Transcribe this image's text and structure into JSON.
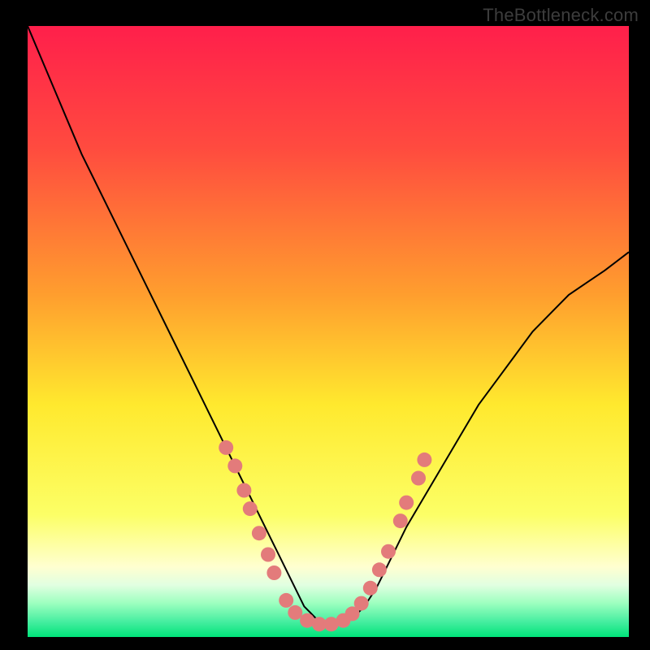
{
  "watermark": "TheBottleneck.com",
  "chart_data": {
    "type": "line",
    "title": "",
    "xlabel": "",
    "ylabel": "",
    "xlim": [
      0,
      100
    ],
    "ylim": [
      0,
      100
    ],
    "grid": false,
    "legend": false,
    "annotations": [],
    "background": {
      "type": "vertical-gradient",
      "stops": [
        {
          "pos": 0.0,
          "color": "#ff1f4b"
        },
        {
          "pos": 0.2,
          "color": "#ff4b3f"
        },
        {
          "pos": 0.44,
          "color": "#ff9e2e"
        },
        {
          "pos": 0.62,
          "color": "#ffe92e"
        },
        {
          "pos": 0.8,
          "color": "#fcff66"
        },
        {
          "pos": 0.885,
          "color": "#ffffd0"
        },
        {
          "pos": 0.915,
          "color": "#e1ffe1"
        },
        {
          "pos": 0.945,
          "color": "#9cffbf"
        },
        {
          "pos": 0.975,
          "color": "#46eea0"
        },
        {
          "pos": 1.0,
          "color": "#00e37a"
        }
      ]
    },
    "series": [
      {
        "name": "curve",
        "color": "#000000",
        "x": [
          0,
          3,
          6,
          9,
          12,
          15,
          18,
          21,
          24,
          27,
          30,
          33,
          36,
          38,
          40,
          42,
          44,
          46,
          48,
          50,
          52,
          54,
          56,
          58,
          60,
          63,
          66,
          69,
          72,
          75,
          78,
          81,
          84,
          87,
          90,
          93,
          96,
          100
        ],
        "y": [
          100,
          93,
          86,
          79,
          73,
          67,
          61,
          55,
          49,
          43,
          37,
          31,
          25,
          21,
          17,
          13,
          9,
          5,
          3,
          2,
          2,
          3,
          5,
          8,
          12,
          18,
          23,
          28,
          33,
          38,
          42,
          46,
          50,
          53,
          56,
          58,
          60,
          63
        ]
      }
    ],
    "markers": {
      "color": "#e37b7b",
      "radius_px": 9,
      "points": [
        {
          "x": 33.0,
          "y": 31.0
        },
        {
          "x": 34.5,
          "y": 28.0
        },
        {
          "x": 36.0,
          "y": 24.0
        },
        {
          "x": 37.0,
          "y": 21.0
        },
        {
          "x": 38.5,
          "y": 17.0
        },
        {
          "x": 40.0,
          "y": 13.5
        },
        {
          "x": 41.0,
          "y": 10.5
        },
        {
          "x": 43.0,
          "y": 6.0
        },
        {
          "x": 44.5,
          "y": 4.0
        },
        {
          "x": 46.5,
          "y": 2.7
        },
        {
          "x": 48.5,
          "y": 2.1
        },
        {
          "x": 50.5,
          "y": 2.1
        },
        {
          "x": 52.5,
          "y": 2.7
        },
        {
          "x": 54.0,
          "y": 3.8
        },
        {
          "x": 55.5,
          "y": 5.5
        },
        {
          "x": 57.0,
          "y": 8.0
        },
        {
          "x": 58.5,
          "y": 11.0
        },
        {
          "x": 60.0,
          "y": 14.0
        },
        {
          "x": 62.0,
          "y": 19.0
        },
        {
          "x": 63.0,
          "y": 22.0
        },
        {
          "x": 65.0,
          "y": 26.0
        },
        {
          "x": 66.0,
          "y": 29.0
        }
      ]
    }
  }
}
